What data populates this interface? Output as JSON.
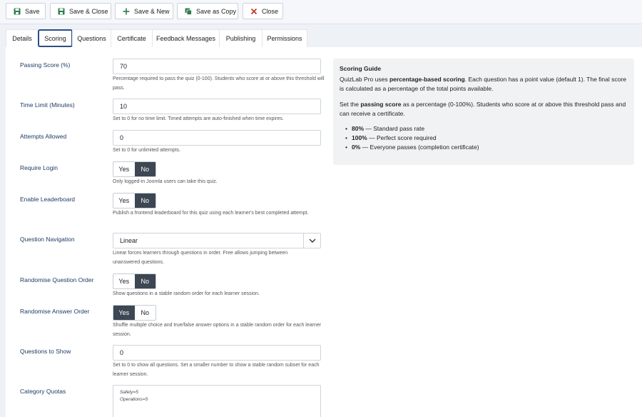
{
  "toolbar": {
    "save": "Save",
    "save_close": "Save & Close",
    "save_new": "Save & New",
    "save_copy": "Save as Copy",
    "close": "Close"
  },
  "tabs": [
    "Details",
    "Scoring",
    "Questions",
    "Certificate",
    "Feedback Messages",
    "Publishing",
    "Permissions"
  ],
  "active_tab": "Scoring",
  "fields": {
    "passing_score": {
      "label": "Passing Score (%)",
      "value": "70",
      "help": "Percentage required to pass the quiz (0-100). Students who score at or above this threshold will pass."
    },
    "time_limit": {
      "label": "Time Limit (Minutes)",
      "value": "10",
      "help": "Set to 0 for no time limit. Timed attempts are auto-finished when time expires."
    },
    "attempts": {
      "label": "Attempts Allowed",
      "value": "0",
      "help": "Set to 0 for unlimited attempts."
    },
    "require_login": {
      "label": "Require Login",
      "yes": "Yes",
      "no": "No",
      "selected": "No",
      "help": "Only logged-in Joomla users can take this quiz."
    },
    "leaderboard": {
      "label": "Enable Leaderboard",
      "yes": "Yes",
      "no": "No",
      "selected": "No",
      "help": "Publish a frontend leaderboard for this quiz using each learner's best completed attempt."
    },
    "navigation": {
      "label": "Question Navigation",
      "value": "Linear",
      "help": "Linear forces learners through questions in order. Free allows jumping between unanswered questions."
    },
    "rand_question": {
      "label": "Randomise Question Order",
      "yes": "Yes",
      "no": "No",
      "selected": "No",
      "help": "Show questions in a stable random order for each learner session."
    },
    "rand_answer": {
      "label": "Randomise Answer Order",
      "yes": "Yes",
      "no": "No",
      "selected": "Yes",
      "help": "Shuffle multiple choice and true/false answer options in a stable random order for each learner session."
    },
    "questions_to_show": {
      "label": "Questions to Show",
      "value": "0",
      "help": "Set to 0 to show all questions. Set a smaller number to show a stable random subset for each learner session."
    },
    "category_quotas": {
      "label": "Category Quotas",
      "lines": [
        "Safety=5",
        "Operations=5"
      ]
    }
  },
  "guide": {
    "title": "Scoring Guide",
    "p1_a": "QuizLab Pro uses ",
    "p1_b": "percentage-based scoring",
    "p1_c": ". Each question has a point value (default 1). The final score is calculated as a percentage of the total points available.",
    "p2_a": "Set the ",
    "p2_b": "passing score",
    "p2_c": " as a percentage (0-100%). Students who score at or above this threshold pass and can receive a certificate.",
    "items": [
      {
        "bold": "80%",
        "text": " — Standard pass rate"
      },
      {
        "bold": "100%",
        "text": " — Perfect score required"
      },
      {
        "bold": "0%",
        "text": " — Everyone passes (completion certificate)"
      }
    ]
  },
  "colors": {
    "accent": "#2a4f84",
    "label": "#1d3c66",
    "toggle_on": "#3d4753",
    "save_icon": "#2e7d4f",
    "close_icon": "#c0392b"
  }
}
